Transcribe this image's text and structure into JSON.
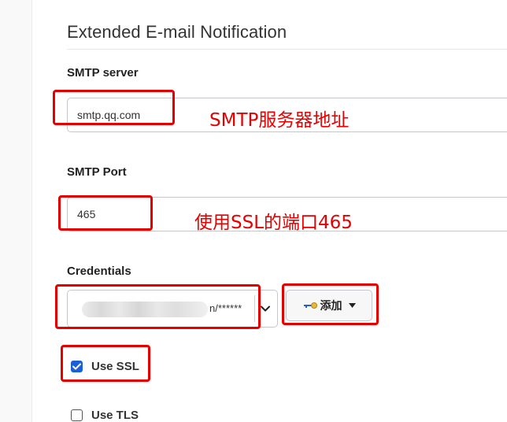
{
  "section": {
    "title": "Extended E-mail Notification"
  },
  "smtp_server": {
    "label": "SMTP server",
    "value": "smtp.qq.com",
    "annotation": "SMTP服务器地址"
  },
  "smtp_port": {
    "label": "SMTP Port",
    "value": "465",
    "annotation": "使用SSL的端口465"
  },
  "credentials": {
    "label": "Credentials",
    "selected_suffix": "n/******",
    "add_label": "添加",
    "icons": {
      "key": "key-icon",
      "dropdown": "chevron-down-icon",
      "caret": "caret-down-icon"
    }
  },
  "use_ssl": {
    "label": "Use SSL",
    "checked": true
  },
  "use_tls": {
    "label": "Use TLS",
    "checked": false
  },
  "colors": {
    "annotation_red": "#e60000",
    "checkbox_blue": "#1a5fd6"
  }
}
